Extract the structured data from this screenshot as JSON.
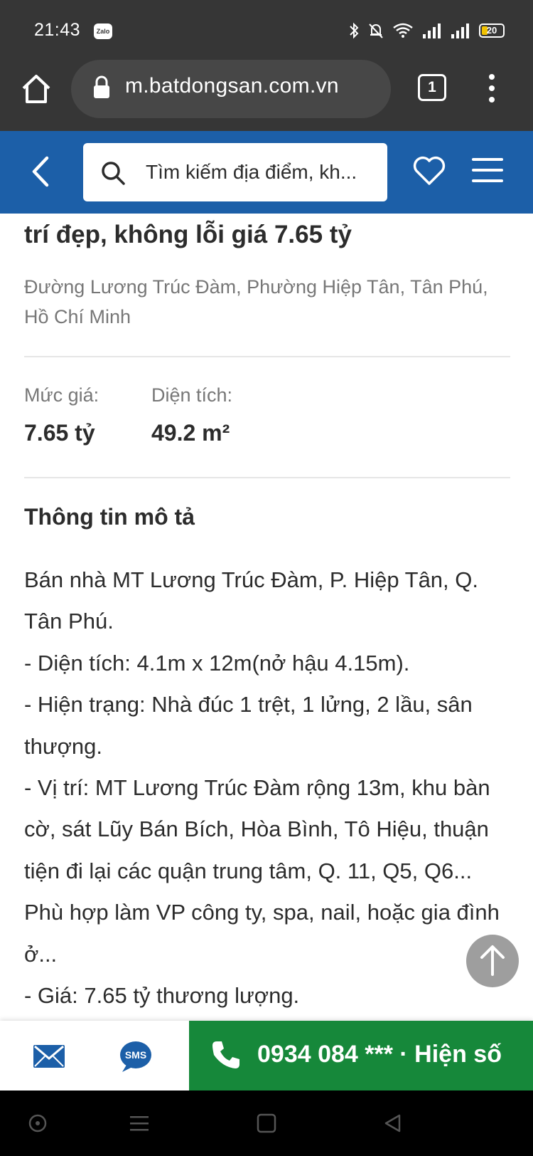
{
  "status_bar": {
    "time": "21:43",
    "zalo_label": "Zalo",
    "battery": "20"
  },
  "browser": {
    "url": "m.batdongsan.com.vn",
    "tab_count": "1"
  },
  "navbar": {
    "search_placeholder": "Tìm kiếm địa điểm, kh..."
  },
  "listing": {
    "title_tail": "trí đẹp, không lỗi giá 7.65 tỷ",
    "address": "Đường Lương Trúc Đàm, Phường Hiệp Tân, Tân Phú, Hồ Chí Minh",
    "price_label": "Mức giá:",
    "price_value": "7.65 tỷ",
    "area_label": "Diện tích:",
    "area_value": "49.2 m²",
    "section_title": "Thông tin mô tả",
    "description": [
      "Bán nhà MT Lương Trúc Đàm, P. Hiệp Tân, Q. Tân Phú.",
      "- Diện tích: 4.1m x 12m(nở hậu 4.15m).",
      "- Hiện trạng: Nhà đúc 1 trệt, 1 lửng, 2 lầu, sân thượng.",
      "- Vị trí: MT Lương Trúc Đàm rộng 13m, khu bàn cờ, sát Lũy Bán Bích, Hòa Bình, Tô Hiệu, thuận tiện đi lại các quận trung tâm, Q. 11, Q5, Q6... Phù hợp làm VP công ty, spa, nail, hoặc gia đình ở...",
      "- Giá: 7.65 tỷ thương lượng."
    ]
  },
  "contact_bar": {
    "sms_label": "SMS",
    "phone_text": "0934 084 *** · Hiện số"
  },
  "colors": {
    "brand_blue": "#1c5fa8",
    "call_green": "#16883a",
    "chrome_dark": "#363636"
  }
}
